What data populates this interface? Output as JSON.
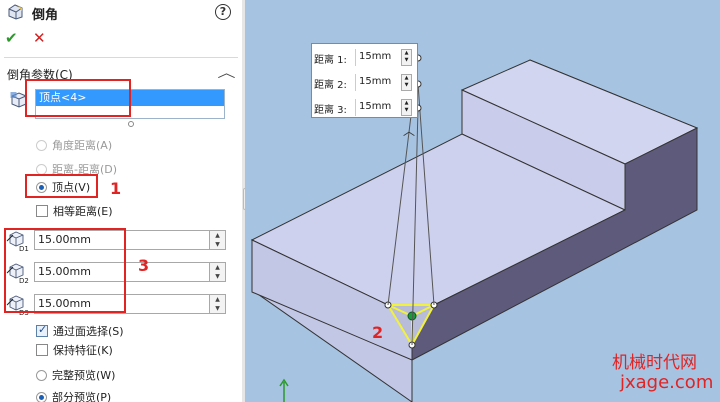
{
  "panel": {
    "title": "倒角",
    "help_label": "?",
    "ok_label": "✔",
    "cancel_label": "✕",
    "section_title": "倒角参数(C)",
    "collapse_label": "︿",
    "selection_item": "顶点<4>",
    "options": {
      "angle_distance": "角度距离(A)",
      "distance_distance": "距离-距离(D)",
      "vertex": "顶点(V)",
      "equal_distance": "相等距离(E)",
      "select_through_faces": "通过面选择(S)",
      "keep_features": "保持特征(K)",
      "full_preview": "完整预览(W)",
      "partial_preview": "部分预览(P)"
    },
    "distances": [
      {
        "label": "D1",
        "value": "15.00mm"
      },
      {
        "label": "D2",
        "value": "15.00mm"
      },
      {
        "label": "D3",
        "value": "15.00mm"
      }
    ]
  },
  "annotations": {
    "one": "1",
    "two": "2",
    "three": "3"
  },
  "callout": {
    "rows": [
      {
        "label": "距离 1:",
        "value": "15mm"
      },
      {
        "label": "距离 2:",
        "value": "15mm"
      },
      {
        "label": "距离 3:",
        "value": "15mm"
      }
    ]
  },
  "watermark": {
    "line1": "机械时代网",
    "line2": "jxage.com"
  },
  "colors": {
    "viewport_bg": "#a6c3e2",
    "model_top": "#cfd3ee",
    "model_front": "#c2c6e4",
    "model_side": "#5f5a7c",
    "highlight_red": "#e02424",
    "chamfer_yellow": "#f2f23a"
  }
}
